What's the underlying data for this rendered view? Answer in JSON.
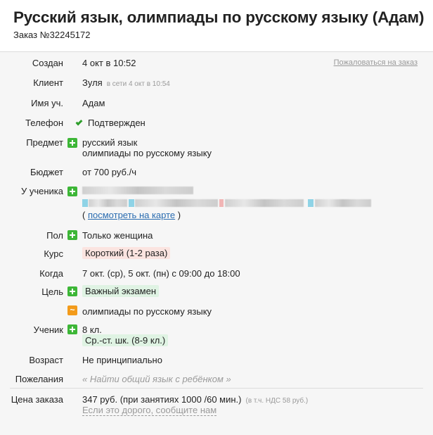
{
  "header": {
    "title": "Русский язык, олимпиады по русскому языку (Адам)",
    "order_number": "Заказ №32245172"
  },
  "report_link": "Пожаловаться на заказ",
  "fields": {
    "created": {
      "label": "Создан",
      "value": "4 окт в 10:52"
    },
    "client": {
      "label": "Клиент",
      "value": "Зуля",
      "status": "в сети 4 окт в 10:54"
    },
    "student_name": {
      "label": "Имя уч.",
      "value": "Адам"
    },
    "phone": {
      "label": "Телефон",
      "value": "Подтвержден"
    },
    "subject": {
      "label": "Предмет",
      "line1": "русский язык",
      "line2": "олимпиады по русскому языку"
    },
    "budget": {
      "label": "Бюджет",
      "value": "от 700 руб./ч"
    },
    "at_student": {
      "label": "У ученика",
      "map_open": "(",
      "map_link": "посмотреть на карте",
      "map_close": ")"
    },
    "gender": {
      "label": "Пол",
      "value": "Только женщина"
    },
    "course": {
      "label": "Курс",
      "value": "Короткий (1-2 раза)"
    },
    "when": {
      "label": "Когда",
      "value": "7 окт. (ср), 5 окт. (пн) с 09:00 до 18:00"
    },
    "goal": {
      "label": "Цель",
      "value": "Важный экзамен",
      "extra": "олимпиады по русскому языку"
    },
    "student": {
      "label": "Ученик",
      "grade": "8 кл.",
      "level": "Ср.-ст. шк. (8-9 кл.)"
    },
    "age": {
      "label": "Возраст",
      "value": "Не принципиально"
    },
    "wishes": {
      "label": "Пожелания",
      "value": "« Найти общий язык с ребёнком »"
    },
    "price": {
      "label": "Цена заказа",
      "value": "347 руб. (при занятиях 1000 /60 мин.)",
      "note": "(в т.ч. НДС 58 руб.)",
      "dearer_link": "Если это дорого, сообщите нам"
    }
  },
  "colors": {
    "accent_green": "#3db637",
    "accent_orange": "#f39b1b",
    "link_blue": "#2a6cb0"
  }
}
